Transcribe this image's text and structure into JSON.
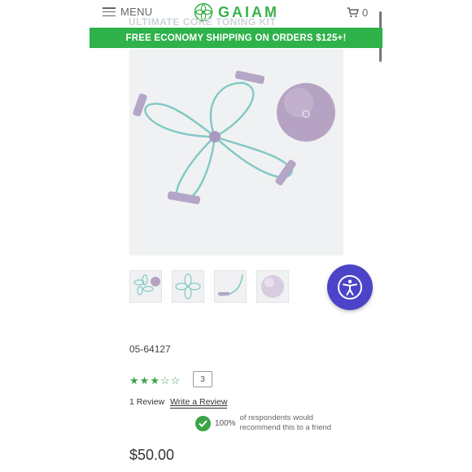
{
  "header": {
    "menu_label": "MENU",
    "logo_text": "GAIAM",
    "cart_count": "0",
    "ghost_title": "ULTIMATE CORE TONING KIT"
  },
  "banner": {
    "text": "FREE ECONOMY SHIPPING ON ORDERS $125+!"
  },
  "product": {
    "sku": "05-64127",
    "rating": 3,
    "rating_max": 5,
    "review_count_box": "3",
    "review_summary": "1 Review",
    "write_review_label": "Write a Review",
    "recommend_pct": "100%",
    "recommend_text": "of respondents would recommend this to a friend",
    "price": "$50.00"
  },
  "colors": {
    "brand_green": "#2fb24a",
    "band_teal": "#7fc9c4",
    "ball_lavender": "#b6a3c4",
    "accessibility_purple": "#4b44c9"
  },
  "icons": [
    "hamburger-icon",
    "gaiam-logo-icon",
    "cart-icon",
    "accessibility-icon",
    "check-icon",
    "star-icon"
  ]
}
